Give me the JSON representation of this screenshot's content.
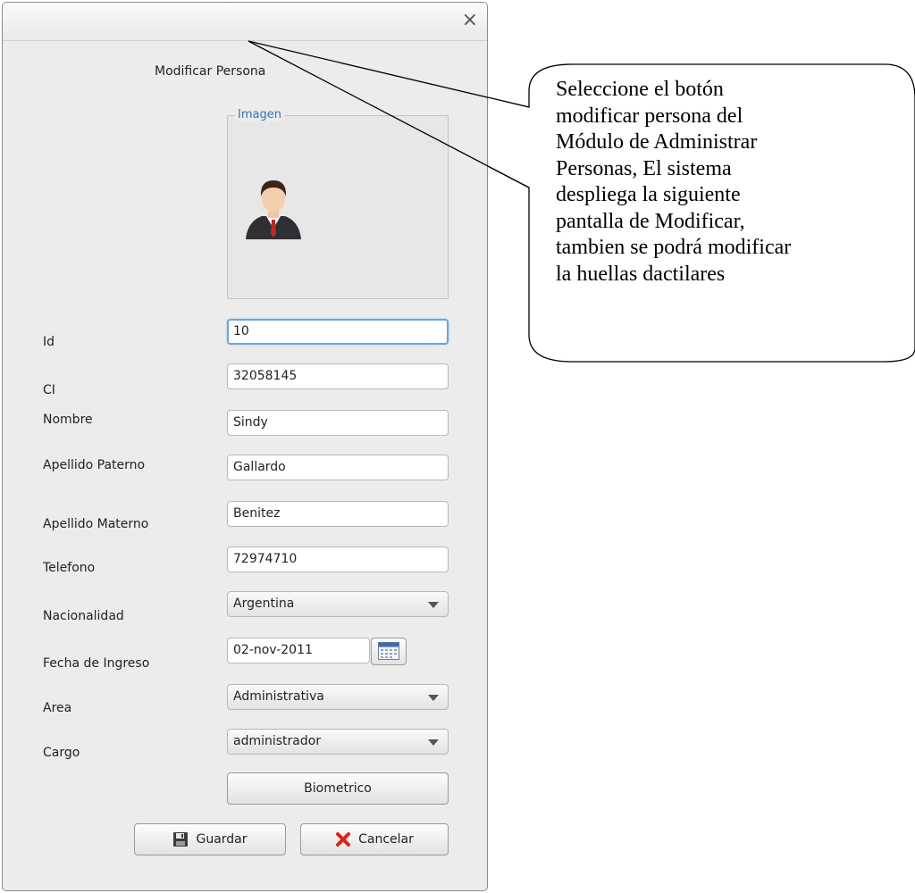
{
  "window": {
    "close_glyph": "×",
    "title": "Modificar Persona"
  },
  "image_panel": {
    "legend": "Imagen",
    "avatar_icon": "person-avatar-icon"
  },
  "form": {
    "fields": {
      "id": {
        "label": "Id",
        "value": "10"
      },
      "ci": {
        "label": "CI",
        "value": "32058145"
      },
      "nombre": {
        "label": "Nombre",
        "value": "Sindy"
      },
      "apellido_paterno": {
        "label": "Apellido Paterno",
        "value": "Gallardo"
      },
      "apellido_materno": {
        "label": "Apellido Materno",
        "value": "Benitez"
      },
      "telefono": {
        "label": "Telefono",
        "value": "72974710"
      },
      "nacionalidad": {
        "label": "Nacionalidad",
        "value": "Argentina"
      },
      "fecha_ingreso": {
        "label": "Fecha de Ingreso",
        "value": "02-nov-2011"
      },
      "area": {
        "label": "Area",
        "value": "Administrativa"
      },
      "cargo": {
        "label": "Cargo",
        "value": "administrador"
      }
    },
    "biometrico_label": "Biometrico",
    "guardar_label": "Guardar",
    "cancelar_label": "Cancelar"
  },
  "callout": {
    "lines": [
      "Seleccione el botón",
      "modificar persona del",
      "Módulo de Administrar",
      "Personas, El sistema",
      "despliega la siguiente",
      "pantalla de Modificar,",
      "tambien se podrá modificar",
      "la huellas dactilares"
    ]
  },
  "colors": {
    "legend": "#2d74b6",
    "focus": "#6aa4d8",
    "cancel_red": "#d9261c"
  }
}
